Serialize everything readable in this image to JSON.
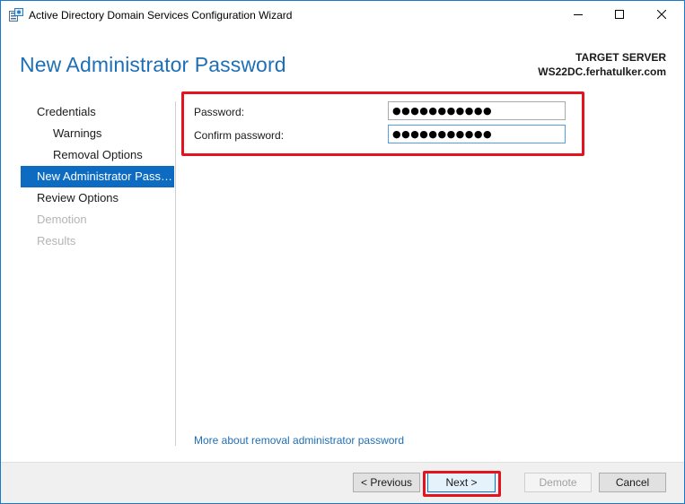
{
  "window": {
    "title": "Active Directory Domain Services Configuration Wizard"
  },
  "header": {
    "page_title": "New Administrator Password",
    "target_server_label": "TARGET SERVER",
    "target_server_name": "WS22DC.ferhatulker.com"
  },
  "nav": {
    "items": [
      {
        "label": "Credentials",
        "state": "normal"
      },
      {
        "label": "Warnings",
        "state": "normal"
      },
      {
        "label": "Removal Options",
        "state": "normal"
      },
      {
        "label": "New Administrator Passw...",
        "state": "active"
      },
      {
        "label": "Review Options",
        "state": "normal"
      },
      {
        "label": "Demotion",
        "state": "disabled"
      },
      {
        "label": "Results",
        "state": "disabled"
      }
    ]
  },
  "form": {
    "password_label": "Password:",
    "password_value": "●●●●●●●●●●●",
    "confirm_label": "Confirm password:",
    "confirm_value": "●●●●●●●●●●●"
  },
  "link": {
    "more_text": "More about removal administrator password"
  },
  "footer": {
    "previous_label": "< Previous",
    "next_label": "Next >",
    "demote_label": "Demote",
    "cancel_label": "Cancel"
  },
  "colors": {
    "accent": "#1e6fb6",
    "active_nav": "#0d6cc2",
    "highlight": "#e3141d",
    "disabled_text": "#b5b5b5"
  },
  "icons": {
    "app": "server-roles-icon",
    "minimize": "minimize-icon",
    "maximize": "maximize-icon",
    "close": "close-icon"
  }
}
